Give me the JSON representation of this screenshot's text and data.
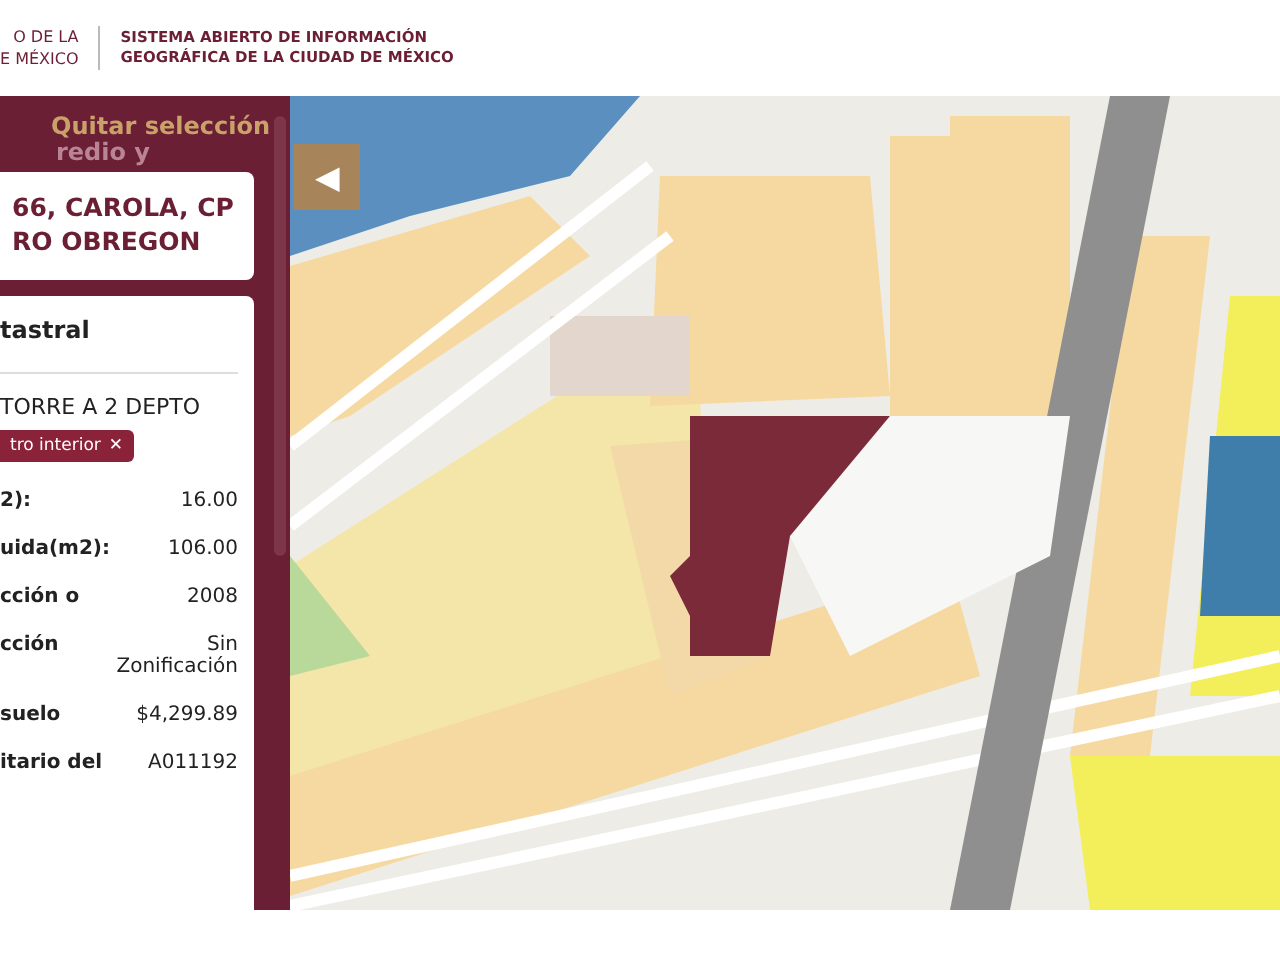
{
  "header": {
    "logo_lines": [
      "O DE LA",
      "E MÉXICO"
    ],
    "title_lines": [
      "SISTEMA ABIERTO DE INFORMACIÓN",
      "GEOGRÁFICA DE LA CIUDAD DE MÉXICO"
    ]
  },
  "panel": {
    "clear_link": "Quitar selección",
    "faded_heading": "redio y",
    "address_lines": [
      "66, CAROLA, CP",
      "RO OBREGON"
    ],
    "card": {
      "title": "tastral",
      "description": "TORRE A 2 DEPTO",
      "chip": {
        "label": "tro interior",
        "close": "✕"
      },
      "rows": [
        {
          "label": "2):",
          "value": "16.00"
        },
        {
          "label": "uida(m2):",
          "value": "106.00"
        },
        {
          "label": "cción o",
          "value": "2008"
        },
        {
          "label": "cción",
          "value": "Sin Zonificación"
        },
        {
          "label": "suelo",
          "value": "$4,299.89"
        },
        {
          "label": "itario del",
          "value": "A011192"
        }
      ]
    }
  },
  "map": {
    "collapse_glyph": "◀"
  }
}
